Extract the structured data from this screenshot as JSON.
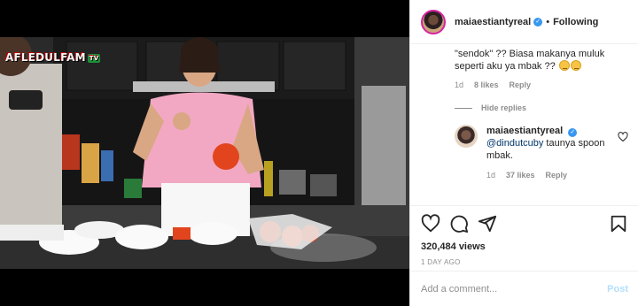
{
  "video": {
    "channel_logo": "AFLEDULFAM",
    "channel_badge": "TV"
  },
  "post_header": {
    "username": "maiaestiantyreal",
    "verified_icon": "verified-badge-icon",
    "separator": "•",
    "follow_status": "Following"
  },
  "comment": {
    "text": "\"sendok\" ?? Biasa makanya muluk seperti aku ya mbak ??",
    "emojis": [
      "grimace-emoji",
      "grimace-emoji"
    ],
    "time": "1d",
    "likes": "8 likes",
    "reply_label": "Reply"
  },
  "replies_toggle": {
    "label": "Hide replies"
  },
  "reply": {
    "username": "maiaestiantyreal",
    "mention": "@dindutcuby",
    "text": " taunya spoon mbak.",
    "time": "1d",
    "likes": "37 likes",
    "reply_label": "Reply"
  },
  "actions": {
    "icons": [
      "heart-icon",
      "comment-icon",
      "share-icon",
      "bookmark-icon"
    ],
    "views": "320,484 views",
    "timestamp": "1 DAY AGO"
  },
  "add_comment": {
    "placeholder": "Add a comment...",
    "post_label": "Post"
  },
  "colors": {
    "link_blue": "#3897f0",
    "post_disabled": "#b2dffc",
    "muted_text": "#8e8e8e",
    "border": "#efefef"
  }
}
